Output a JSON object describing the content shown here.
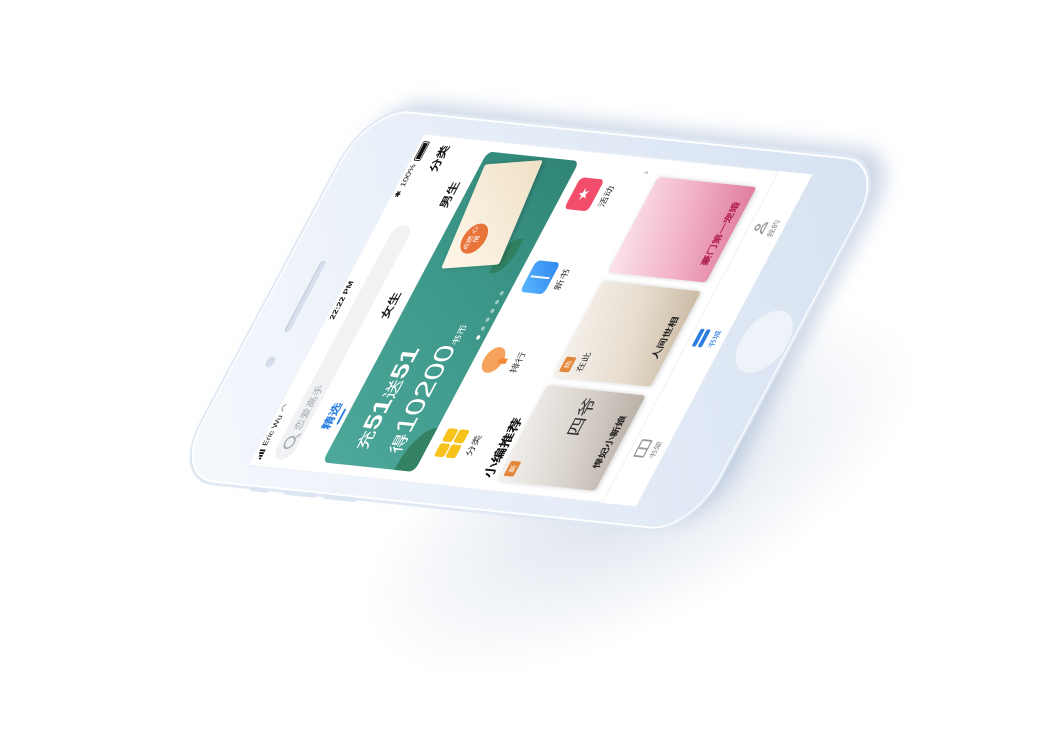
{
  "status_bar": {
    "carrier": "Eric Wu",
    "time": "22:22 PM",
    "battery": "100%"
  },
  "header": {
    "search_placeholder": "恋爱高手",
    "category_label": "分类"
  },
  "tabs": [
    {
      "label": "精选",
      "active": true
    },
    {
      "label": "女生",
      "active": false
    },
    {
      "label": "男生",
      "active": false
    }
  ],
  "banner": {
    "line1_prefix": "充",
    "line1_a": "51",
    "line1_mid": "送",
    "line1_b": "51",
    "line2_prefix": "得",
    "line2_value": "10200",
    "line2_unit": "书币",
    "badge": "点燃 心情",
    "page_count": 6,
    "active_page": 1
  },
  "quick_entries": [
    {
      "label": "分类",
      "icon": "grid-icon"
    },
    {
      "label": "排行",
      "icon": "trophy-icon"
    },
    {
      "label": "新书",
      "icon": "book-icon"
    },
    {
      "label": "活动",
      "icon": "ticket-icon"
    }
  ],
  "recommend": {
    "title": "小编推荐",
    "more": "›",
    "books": [
      {
        "title": "悍妃小新娘",
        "top": "四爷",
        "flag": "新"
      },
      {
        "title": "人间世相",
        "top": "在此",
        "flag": "热"
      },
      {
        "title": "豪门第一宠婚",
        "top": "",
        "flag": ""
      }
    ]
  },
  "tab_bar": [
    {
      "label": "书架",
      "active": false
    },
    {
      "label": "书城",
      "active": true
    },
    {
      "label": "我的",
      "active": false
    }
  ],
  "colors": {
    "accent": "#2a7de1",
    "banner": "#4ea89b",
    "phone_body": "#e7eef8"
  }
}
